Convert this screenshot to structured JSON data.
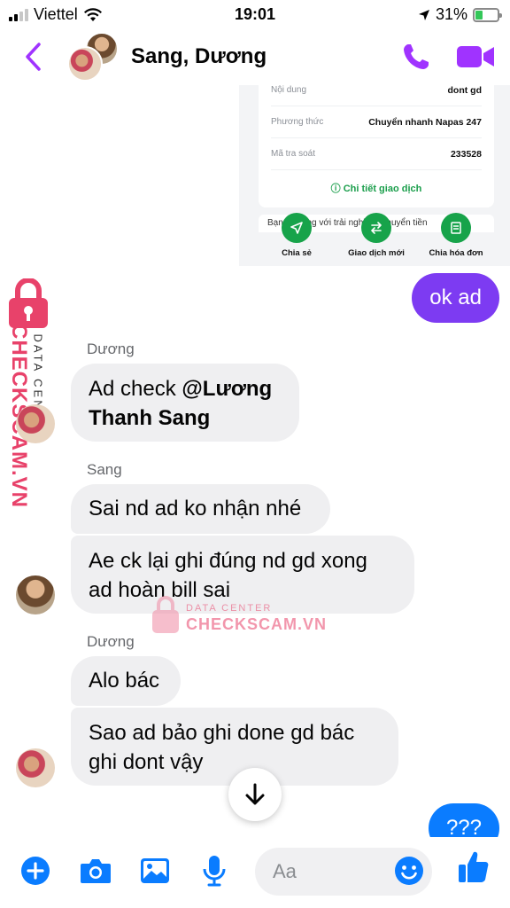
{
  "status_bar": {
    "carrier": "Viettel",
    "time": "19:01",
    "battery": "31%"
  },
  "header": {
    "title": "Sang, Dương"
  },
  "receipt": {
    "rows": [
      {
        "label": "Nội dung",
        "value": "dont gd"
      },
      {
        "label": "Phương thức",
        "value": "Chuyển nhanh Napas 247"
      },
      {
        "label": "Mã tra soát",
        "value": "233528"
      }
    ],
    "detail_link": "Chi tiết giao dịch",
    "note": "Bạn hài lòng với trải nghiệm Chuyển tiền",
    "actions": [
      {
        "label": "Chia sẻ",
        "icon": "share-icon"
      },
      {
        "label": "Giao dịch mới",
        "icon": "swap-icon"
      },
      {
        "label": "Chia hóa đơn",
        "icon": "bill-icon"
      }
    ]
  },
  "messages": {
    "m1": "ok ad",
    "sender1": "Dương",
    "m2_text": "Ad check ",
    "m2_mention_a": "@Lương",
    "m2_mention_b": "Thanh Sang",
    "sender2": "Sang",
    "m3": "Sai nd ad ko nhận nhé",
    "m4_line1": "Ae ck lại ghi đúng nd gd xong",
    "m4_line2": "ad hoàn bill sai",
    "sender3": "Dương",
    "m5": "Alo bác",
    "m6_line1": "Sao ad bảo ghi done gd bác",
    "m6_line2": "ghi dont vậy",
    "m7": "???"
  },
  "watermark": {
    "brand": "CHECKSCAM.VN",
    "tag": "DATA CENTER",
    "color": "#e8426a"
  },
  "composer": {
    "placeholder": "Aa"
  },
  "colors": {
    "accent": "#a033ff",
    "outgoing_bubble": "#7d3bf2",
    "messenger_blue": "#0a7cff"
  }
}
